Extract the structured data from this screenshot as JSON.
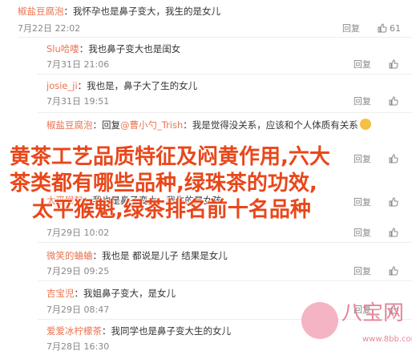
{
  "comments": [
    {
      "name": "椒盐豆腐泡",
      "sep": "：",
      "text": "我怀孕也是鼻子变大，我生的是女儿",
      "time": "7月22日 22:02",
      "reply": "回复",
      "likes": "61"
    },
    {
      "name": "Slu哈喽",
      "sep": "：",
      "text": "我也鼻子变大也是闺女",
      "time": "7月31日 21:06",
      "reply": "回复",
      "likes": ""
    },
    {
      "name": "josie_ji",
      "sep": "：",
      "text": "我也是，鼻子大了生的女儿",
      "time": "7月31日 19:51",
      "reply": "回复",
      "likes": ""
    },
    {
      "name": "椒盐豆腐泡",
      "sep": "：",
      "reply_prefix": "回复",
      "reply_to": "@曹小勺_Trish",
      "text": "：我是觉得没关系，应该和个人体质有关系",
      "time": "",
      "reply": "",
      "likes": ""
    },
    {
      "name": "",
      "sep": "",
      "text": "",
      "time": "",
      "reply": "回复",
      "likes": ""
    },
    {
      "name": "太平猴魁",
      "sep": "：",
      "text": "我也是鼻子变大，我生的是女孩",
      "time": "",
      "reply": "回复",
      "likes": ""
    },
    {
      "name": "",
      "sep": "",
      "text": "",
      "time": "7月29日 10:02",
      "reply": "回复",
      "likes": ""
    },
    {
      "name": "微笑的蛐蛐",
      "sep": "：",
      "text": "我也是 都说是儿子 结果是女儿",
      "time": "7月29日 09:25",
      "reply": "回复",
      "likes": ""
    },
    {
      "name": "吉宝児",
      "sep": "：",
      "text": "我姐鼻子变大，是女儿",
      "time": "7月29日 08:47",
      "reply": "回复",
      "likes": ""
    },
    {
      "name": "爱爱冰柠檬茶",
      "sep": "：",
      "text": "我同学也是鼻子变大生的女儿",
      "time": "7月28日 16:30",
      "reply": "回复",
      "likes": ""
    }
  ],
  "overlay": {
    "line1": "黄茶工艺品质特征及闷黄作用,六大",
    "line2": "茶类都有哪些品种,绿珠茶的功效,",
    "line3": "太平猴魁,绿茶排名前十名品种"
  },
  "watermark": {
    "text": "八宝网",
    "url": "www.8bb.com"
  },
  "colors": {
    "accent": "#eb7350",
    "overlay": "#e8471a",
    "muted": "#888888"
  }
}
